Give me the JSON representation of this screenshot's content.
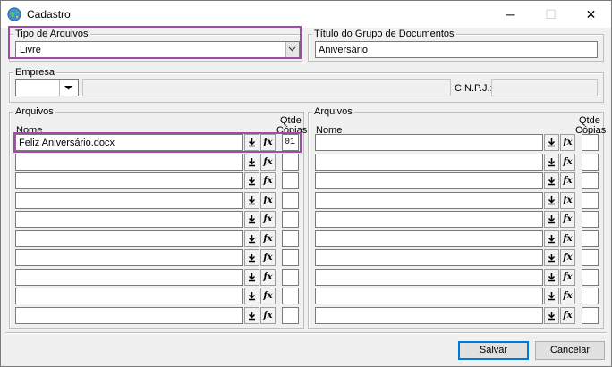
{
  "window": {
    "title": "Cadastro",
    "minimize": "─",
    "maximize": "☐",
    "close": "✕"
  },
  "tipo_arquivos": {
    "label": "Tipo de Arquivos",
    "value": "Livre"
  },
  "titulo_grupo": {
    "label": "Título do Grupo de Documentos",
    "value": "Aniversário"
  },
  "empresa": {
    "label": "Empresa",
    "value": "",
    "name_value": "",
    "cnpj_label": "C.N.P.J.:",
    "cnpj_value": ""
  },
  "arquivos_left": {
    "label": "Arquivos",
    "col_nome": "Nome",
    "col_qtde": "Qtde",
    "col_copias": "Cópias",
    "rows": [
      {
        "nome": "Feliz Aniversário.docx",
        "qtde": "01"
      },
      {
        "nome": "",
        "qtde": ""
      },
      {
        "nome": "",
        "qtde": ""
      },
      {
        "nome": "",
        "qtde": ""
      },
      {
        "nome": "",
        "qtde": ""
      },
      {
        "nome": "",
        "qtde": ""
      },
      {
        "nome": "",
        "qtde": ""
      },
      {
        "nome": "",
        "qtde": ""
      },
      {
        "nome": "",
        "qtde": ""
      },
      {
        "nome": "",
        "qtde": ""
      }
    ]
  },
  "arquivos_right": {
    "label": "Arquivos",
    "col_nome": "Nome",
    "col_qtde": "Qtde",
    "col_copias": "Cópias",
    "rows": [
      {
        "nome": "",
        "qtde": ""
      },
      {
        "nome": "",
        "qtde": ""
      },
      {
        "nome": "",
        "qtde": ""
      },
      {
        "nome": "",
        "qtde": ""
      },
      {
        "nome": "",
        "qtde": ""
      },
      {
        "nome": "",
        "qtde": ""
      },
      {
        "nome": "",
        "qtde": ""
      },
      {
        "nome": "",
        "qtde": ""
      },
      {
        "nome": "",
        "qtde": ""
      },
      {
        "nome": "",
        "qtde": ""
      }
    ]
  },
  "buttons": {
    "download_glyph": "⭳",
    "fx_glyph": "fx",
    "salvar_key": "S",
    "salvar_rest": "alvar",
    "cancelar_key": "C",
    "cancelar_rest": "ancelar"
  },
  "icons": {
    "app": "globe-icon",
    "download": "download-icon",
    "function": "function-icon",
    "dropdown": "chevron-down-icon"
  },
  "colors": {
    "highlight": "#a14ba8",
    "window_bg": "#f0f0f0"
  }
}
